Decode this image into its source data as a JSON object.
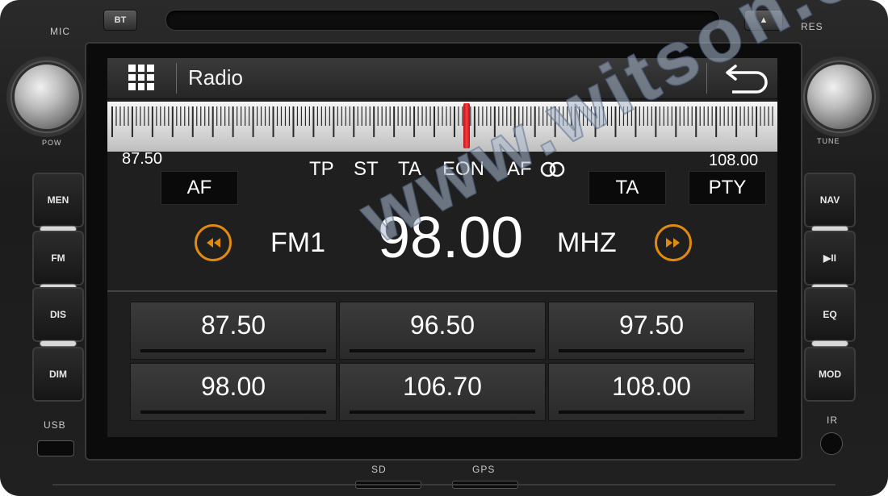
{
  "hardware": {
    "mic_label": "MIC",
    "bt_label": "BT",
    "eject_label": "▲",
    "res_label": "RES",
    "pow_label": "POW",
    "tune_label": "TUNE",
    "left_buttons": [
      "MEN",
      "FM",
      "DIS",
      "DIM"
    ],
    "right_buttons": [
      "NAV",
      "▶II",
      "EQ",
      "MOD"
    ],
    "usb_label": "USB",
    "ir_label": "IR",
    "sd_label": "SD",
    "gps_label": "GPS"
  },
  "header": {
    "title": "Radio",
    "menu_icon": "grid-menu-icon",
    "back_icon": "back-arrow-icon"
  },
  "tuner": {
    "scale_min": "87.50",
    "scale_max": "108.00",
    "needle_fraction": 0.5366,
    "flags": [
      "TP",
      "ST",
      "TA",
      "EON",
      "AF"
    ],
    "af_link_icon": "link-rings-icon",
    "af_button": "AF",
    "ta_button": "TA",
    "pty_button": "PTY",
    "band": "FM1",
    "frequency": "98.00",
    "unit": "MHZ",
    "seek_prev_icon": "rewind-icon",
    "seek_next_icon": "fast-forward-icon",
    "accent_color": "#e08a12"
  },
  "presets": [
    "87.50",
    "96.50",
    "97.50",
    "98.00",
    "106.70",
    "108.00"
  ],
  "watermark": "www.witson.com"
}
